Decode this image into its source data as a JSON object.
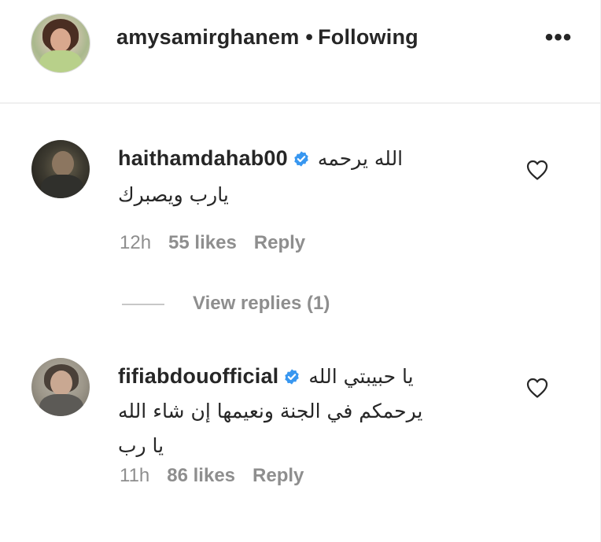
{
  "post": {
    "username": "amysamirghanem",
    "separator": "•",
    "follow_status": "Following",
    "more_label": "•••"
  },
  "comments": [
    {
      "username": "haithamdahab00",
      "lines": [
        "الله يرحمه",
        "يارب ويصبرك"
      ],
      "time": "12h",
      "likes": "55 likes",
      "reply": "Reply",
      "view_replies": "View replies (1)"
    },
    {
      "username": "fifiabdouofficial",
      "lines": [
        "يا حبيبتي الله",
        "يرحمكم في الجنة ونعيمها إن شاء الله",
        "يا رب"
      ],
      "time": "11h",
      "likes": "86 likes",
      "reply": "Reply"
    }
  ],
  "colors": {
    "text": "#262626",
    "secondary": "#8e8e8e",
    "verified": "#3897f0",
    "divider": "#efefef"
  },
  "icons": {
    "verified": "verified-badge-icon",
    "heart": "heart-outline-icon",
    "more": "more-options-icon"
  }
}
